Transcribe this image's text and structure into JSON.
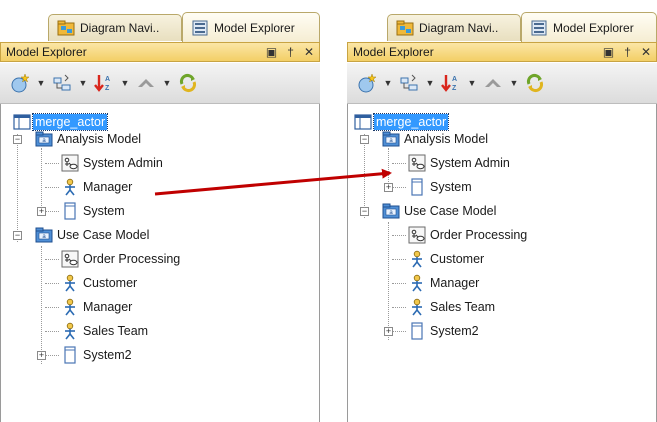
{
  "colors": {
    "selection": "#3399ff",
    "arrow": "#c00000",
    "titlebar": "#f3cf66"
  },
  "left_panel": {
    "tabs": [
      {
        "label": "Diagram Navi..",
        "icon": "diagram-navigator-icon"
      },
      {
        "label": "Model Explorer",
        "icon": "model-explorer-icon",
        "active": true
      }
    ],
    "title": "Model Explorer",
    "window_controls": [
      "restore-icon",
      "pin-icon",
      "close-icon"
    ],
    "window_control_glyphs": [
      "▣",
      "†",
      "✕"
    ],
    "tree": {
      "root": "merge_actor",
      "analysis_model": "Analysis Model",
      "system_admin": "System Admin",
      "manager_moved": "Manager",
      "system": "System",
      "use_case_model": "Use Case Model",
      "order_processing": "Order Processing",
      "customer": "Customer",
      "manager": "Manager",
      "sales_team": "Sales Team",
      "system2": "System2"
    }
  },
  "right_panel": {
    "tabs": [
      {
        "label": "Diagram Navi..",
        "icon": "diagram-navigator-icon"
      },
      {
        "label": "Model Explorer",
        "icon": "model-explorer-icon",
        "active": true
      }
    ],
    "title": "Model Explorer",
    "window_controls": [
      "restore-icon",
      "pin-icon",
      "close-icon"
    ],
    "window_control_glyphs": [
      "▣",
      "†",
      "✕"
    ],
    "tree": {
      "root": "merge_actor",
      "analysis_model": "Analysis Model",
      "system_admin": "System Admin",
      "system": "System",
      "use_case_model": "Use Case Model",
      "order_processing": "Order Processing",
      "customer": "Customer",
      "manager": "Manager",
      "sales_team": "Sales Team",
      "system2": "System2"
    }
  },
  "toolbar_icons": [
    "new-model-icon",
    "tree-view-icon",
    "sort-icon",
    "up-level-icon",
    "refresh-icon"
  ]
}
